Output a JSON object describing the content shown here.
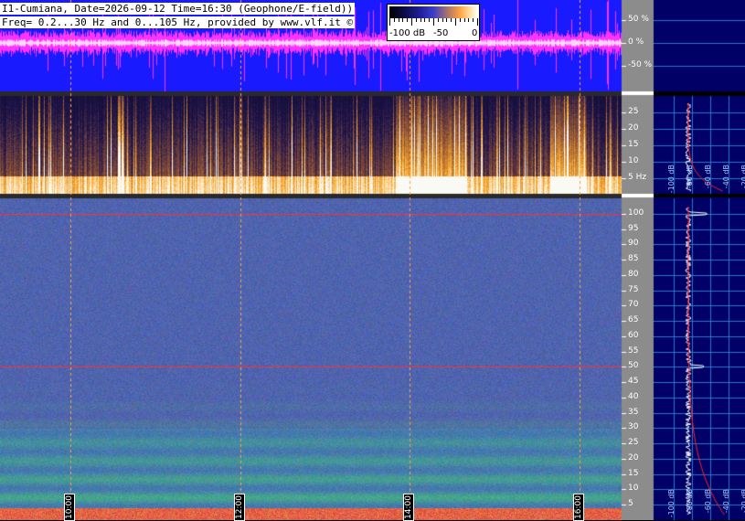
{
  "header": {
    "line1": "I1-Cumiana, Date=2026-09-12 Time=16:30 (Geophone/E-field))",
    "line2": "Freq= 0.2...30 Hz and 0...105 Hz, provided by www.vlf.it ©"
  },
  "colorbar": {
    "labels": [
      "-100 dB",
      "-50",
      "0"
    ]
  },
  "colors": {
    "waveform_bg": "#1a1aff",
    "waveform_trace": "#ff33ff",
    "side_panel_bg": "#000066",
    "axis_strip_bg": "#8c8c8c",
    "marker_line": "#ff3030",
    "grid_line": "#ffa040",
    "profile_line": "#ffffff",
    "profile_fit": "#ff2020",
    "side_grid": "#2a7acc"
  },
  "chart_data": [
    {
      "type": "line",
      "panel": "waveform",
      "ytick_labels": [
        "50 %",
        "0 %",
        "-50 %"
      ],
      "ylim": [
        -100,
        100
      ],
      "yunit": "%"
    },
    {
      "type": "heatmap",
      "panel": "spectrogram-low",
      "ytick_labels": [
        "25",
        "20",
        "15",
        "10",
        "5 Hz"
      ],
      "yticks": [
        25,
        20,
        15,
        10,
        5
      ],
      "ylim": [
        0.2,
        30
      ],
      "yunit": "Hz",
      "colorscale_db": [
        -100,
        0
      ],
      "side_profile_labels": [
        "-100 dB",
        "-80 dB",
        "-60 dB",
        "-40 dB",
        "-20 dB"
      ],
      "bright_event_time_ranges": [
        [
          "13:50",
          "14:40"
        ],
        [
          "15:40",
          "16:05"
        ]
      ]
    },
    {
      "type": "heatmap",
      "panel": "spectrogram-high",
      "ytick_labels": [
        "100",
        "95",
        "90",
        "85",
        "80",
        "75",
        "70",
        "65",
        "60",
        "55",
        "50",
        "45",
        "40",
        "35",
        "30",
        "25",
        "20",
        "15",
        "10",
        "5"
      ],
      "yticks": [
        100,
        95,
        90,
        85,
        80,
        75,
        70,
        65,
        60,
        55,
        50,
        45,
        40,
        35,
        30,
        25,
        20,
        15,
        10,
        5
      ],
      "ylim": [
        0,
        105
      ],
      "yunit": "Hz",
      "marker_lines_hz": [
        100,
        50
      ],
      "side_profile_labels": [
        "-100 dB",
        "-80 dB",
        "-60 dB",
        "-40 dB",
        "-20 dB"
      ]
    }
  ],
  "time_axis": {
    "labels": [
      "10:00",
      "12:00",
      "14:00",
      "16:00"
    ],
    "start": "09:10",
    "end": "16:30"
  }
}
